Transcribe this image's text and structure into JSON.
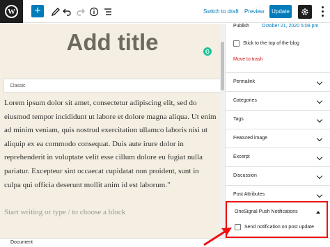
{
  "toolbar": {
    "add_label": "+",
    "switch_draft": "Switch to draft",
    "preview": "Preview",
    "update": "Update"
  },
  "editor": {
    "title_placeholder": "Add title",
    "grammarly_badge": "G",
    "classic_label": "Classic",
    "body_text": "Lorem ipsum dolor sit amet, consectetur adipiscing elit, sed do eiusmod tempor incididunt ut labore et dolore magna aliqua. Ut enim ad minim veniam, quis nostrud exercitation ullamco laboris nisi ut aliquip ex ea commodo consequat. Duis aute irure dolor in reprehenderit in voluptate velit esse cillum dolore eu fugiat nulla pariatur. Excepteur sint occaecat cupidatat non proident, sunt in culpa qui officia deserunt mollit anim id est laborum.\"",
    "block_placeholder": "Start writing or type / to choose a block"
  },
  "sidebar": {
    "publish_label": "Publish",
    "publish_date": "October 21, 2020 5:09 pm",
    "stick_label": "Stick to the top of the blog",
    "trash": "Move to trash",
    "panels": [
      {
        "label": "Permalink"
      },
      {
        "label": "Categories"
      },
      {
        "label": "Tags"
      },
      {
        "label": "Featured image"
      },
      {
        "label": "Excerpt"
      },
      {
        "label": "Discussion"
      },
      {
        "label": "Post Attributes"
      }
    ],
    "onesignal": {
      "title": "OneSignal Push Notifications",
      "checkbox_label": "Send notification on post update"
    }
  },
  "footer": {
    "label": "Document"
  },
  "colors": {
    "accent": "#007cba",
    "canvas": "#f4efe2",
    "highlight": "#ee1111",
    "danger": "#cc1818"
  }
}
